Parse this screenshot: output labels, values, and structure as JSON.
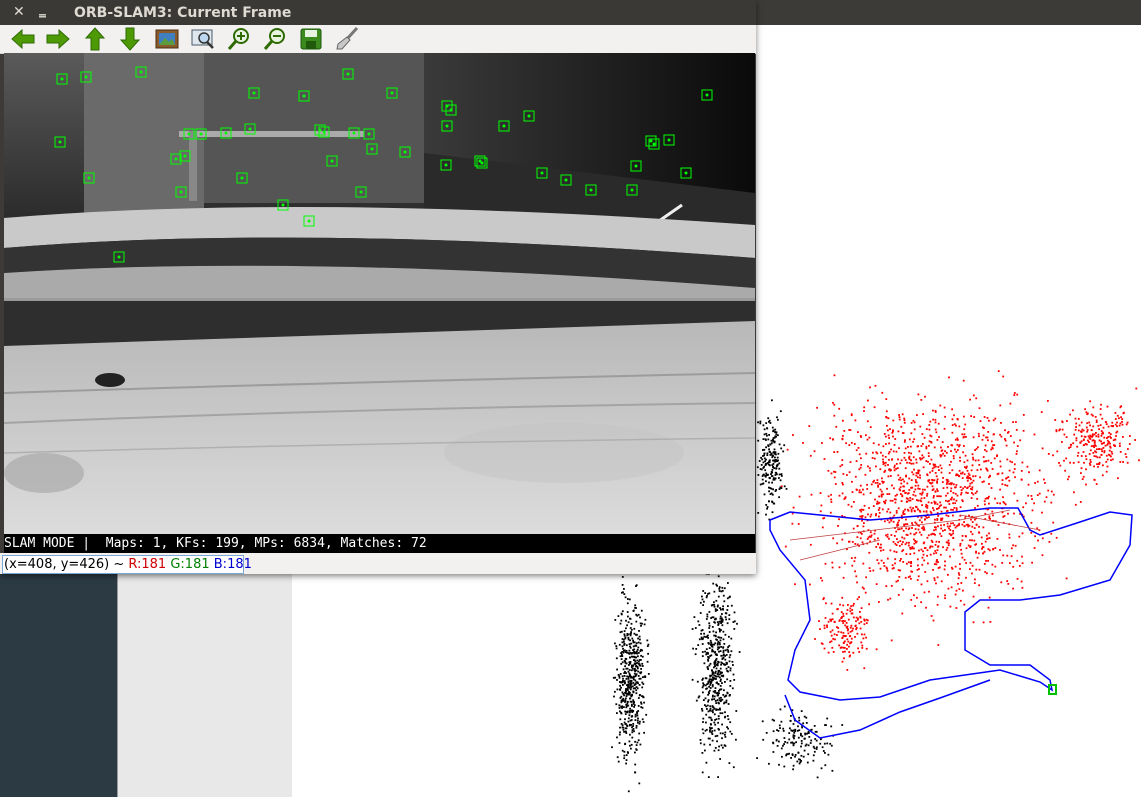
{
  "window": {
    "title": "ORB-SLAM3: Current Frame",
    "close_glyph": "✕",
    "minimize_glyph": "‗"
  },
  "toolbar": {
    "buttons": [
      {
        "name": "pan-left",
        "icon": "arrow-left-icon"
      },
      {
        "name": "pan-right",
        "icon": "arrow-right-icon"
      },
      {
        "name": "pan-up",
        "icon": "arrow-up-icon"
      },
      {
        "name": "pan-down",
        "icon": "arrow-down-icon"
      },
      {
        "name": "zoom-fit",
        "icon": "image-icon"
      },
      {
        "name": "zoom-original",
        "icon": "zoom-window-icon"
      },
      {
        "name": "zoom-in",
        "icon": "zoom-in-icon"
      },
      {
        "name": "zoom-out",
        "icon": "zoom-out-icon"
      },
      {
        "name": "save",
        "icon": "save-icon"
      },
      {
        "name": "properties",
        "icon": "brush-icon"
      }
    ]
  },
  "status": {
    "text": "SLAM MODE |  Maps: 1, KFs: 199, MPs: 6834, Matches: 72"
  },
  "pixel_info": {
    "coords": "(x=408, y=426) ~ ",
    "r": "R:181",
    "g": "G:181",
    "b": "B:181"
  },
  "colors": {
    "feature_box": "#00ff00",
    "map_point_active": "#ff0000",
    "map_point": "#000000",
    "trajectory": "#0000ff",
    "status_r": "#d00000",
    "status_g": "#008000",
    "status_b": "#0000d0"
  }
}
